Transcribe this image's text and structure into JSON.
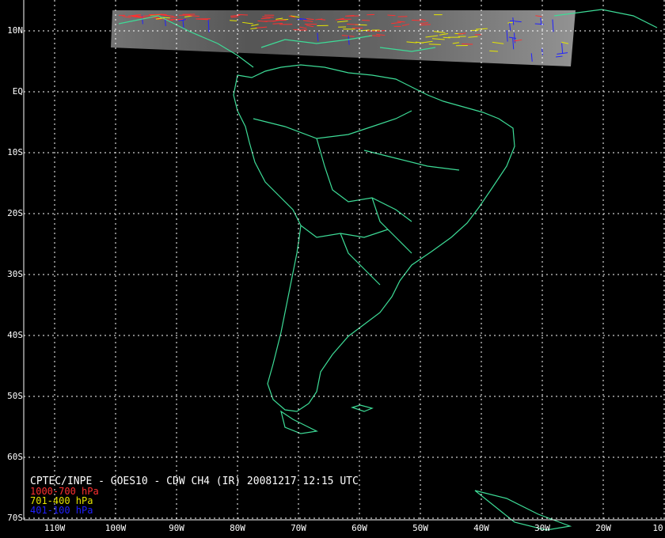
{
  "map": {
    "background": "#000000",
    "grid_color": "#ffffff",
    "coast_color": "#3ddc97",
    "lat_labels": [
      "10N",
      "EQ",
      "10S",
      "20S",
      "30S",
      "40S",
      "50S",
      "60S",
      "70S"
    ],
    "lon_labels": [
      "110W",
      "100W",
      "90W",
      "80W",
      "70W",
      "60W",
      "50W",
      "40W",
      "30W",
      "20W",
      "10"
    ]
  },
  "legend": {
    "title": "CPTEC/INPE - GOES10 - CDW CH4 (IR) 20081217 12:15 UTC",
    "levels": [
      {
        "label": "1000-700 hPa",
        "color": "#ff3030"
      },
      {
        "label": "701-400 hPa",
        "color": "#e6e600"
      },
      {
        "label": "401-100 hPa",
        "color": "#2020ff"
      }
    ]
  }
}
